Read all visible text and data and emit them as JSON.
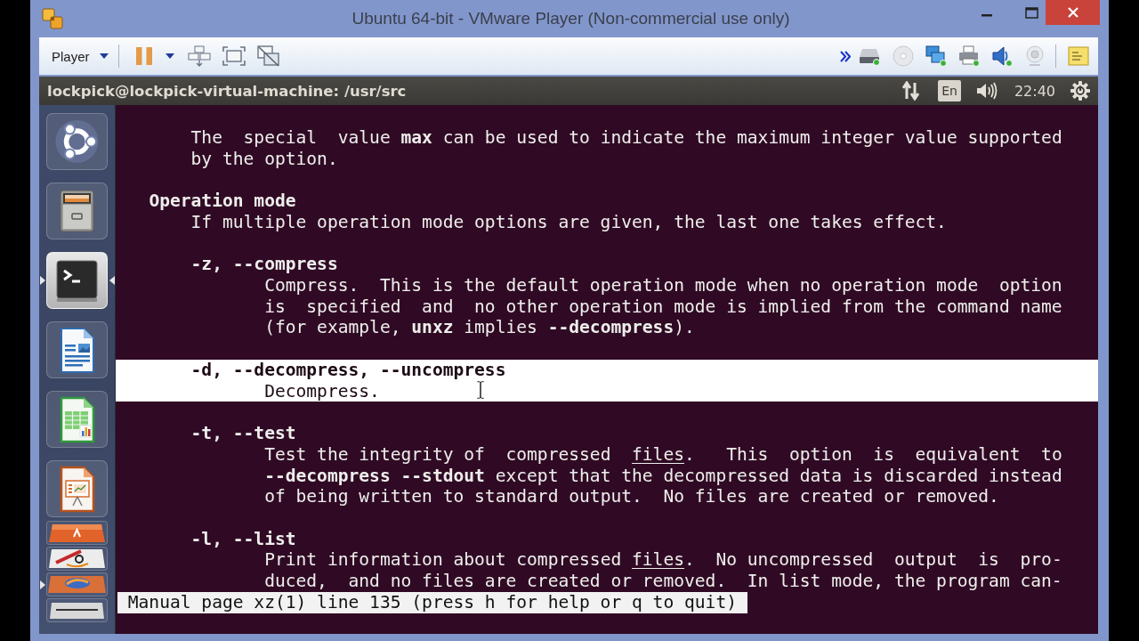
{
  "window": {
    "title": "Ubuntu 64-bit - VMware Player (Non-commercial use only)"
  },
  "toolbar": {
    "menu": "Player"
  },
  "top_panel": {
    "title": "lockpick@lockpick-virtual-machine: /usr/src",
    "keyboard_layout": "En",
    "clock": "22:40"
  },
  "launcher": [
    {
      "kind": "dash",
      "folded": false,
      "running": false,
      "focused": false
    },
    {
      "kind": "files",
      "folded": false,
      "running": false,
      "focused": false
    },
    {
      "kind": "terminal",
      "folded": false,
      "running": true,
      "focused": true
    },
    {
      "kind": "document",
      "folded": false,
      "running": false,
      "focused": false
    },
    {
      "kind": "spreadsheet",
      "folded": false,
      "running": false,
      "focused": false
    },
    {
      "kind": "presentation",
      "folded": false,
      "running": false,
      "focused": false
    },
    {
      "kind": "store",
      "folded": true,
      "running": false,
      "focused": false
    },
    {
      "kind": "shop",
      "folded": true,
      "running": false,
      "focused": false
    },
    {
      "kind": "browser",
      "folded": true,
      "running": true,
      "focused": false
    },
    {
      "kind": "trash",
      "folded": true,
      "running": false,
      "focused": false
    }
  ],
  "terminal": {
    "blocks": [
      {
        "highlighted": false,
        "lines": [
          {
            "kind": "para",
            "text": "The  special  value **max** can be used to indicate the maximum integer value supported"
          },
          {
            "kind": "para",
            "text": "by the option."
          }
        ]
      },
      {
        "highlighted": false,
        "lines": [
          {
            "kind": "heading",
            "text": "Operation mode"
          },
          {
            "kind": "para",
            "text": "If multiple operation mode options are given, the last one takes effect."
          }
        ]
      },
      {
        "highlighted": false,
        "lines": [
          {
            "kind": "option",
            "text": "-z, --compress"
          },
          {
            "kind": "desc",
            "text": "Compress.  This is the default operation mode when no operation mode  option"
          },
          {
            "kind": "desc",
            "text": "is  specified  and  no other operation mode is implied from the command name"
          },
          {
            "kind": "desc",
            "text": "(for example, **unxz** implies **--decompress**)."
          }
        ]
      },
      {
        "highlighted": true,
        "lines": [
          {
            "kind": "option",
            "text": "-d, --decompress, --uncompress"
          },
          {
            "kind": "desc",
            "text": "Decompress."
          }
        ]
      },
      {
        "highlighted": false,
        "lines": [
          {
            "kind": "option",
            "text": "-t, --test"
          },
          {
            "kind": "desc",
            "segments": [
              {
                "kind": "text",
                "text": "Test the integrity of  compressed  "
              },
              {
                "kind": "underlined",
                "text": "files"
              },
              {
                "kind": "text",
                "text": ".   This  option  is  equivalent  to"
              }
            ]
          },
          {
            "kind": "desc",
            "text": "**--decompress --stdout** except that the decompressed data is discarded instead"
          },
          {
            "kind": "desc",
            "text": "of being written to standard output.  No files are created or removed."
          }
        ]
      },
      {
        "highlighted": false,
        "lines": [
          {
            "kind": "option",
            "text": "-l, --list"
          },
          {
            "kind": "desc",
            "segments": [
              {
                "kind": "text",
                "text": "Print information about compressed "
              },
              {
                "kind": "underlined",
                "text": "files"
              },
              {
                "kind": "text",
                "text": ".  No uncompressed  output  is  pro-"
              }
            ]
          },
          {
            "kind": "desc",
            "text": "duced,  and no files are created or removed.  In list mode, the program can-"
          }
        ]
      }
    ],
    "status_line": "Manual page xz(1) line 135 (press h for help or q to quit)"
  }
}
